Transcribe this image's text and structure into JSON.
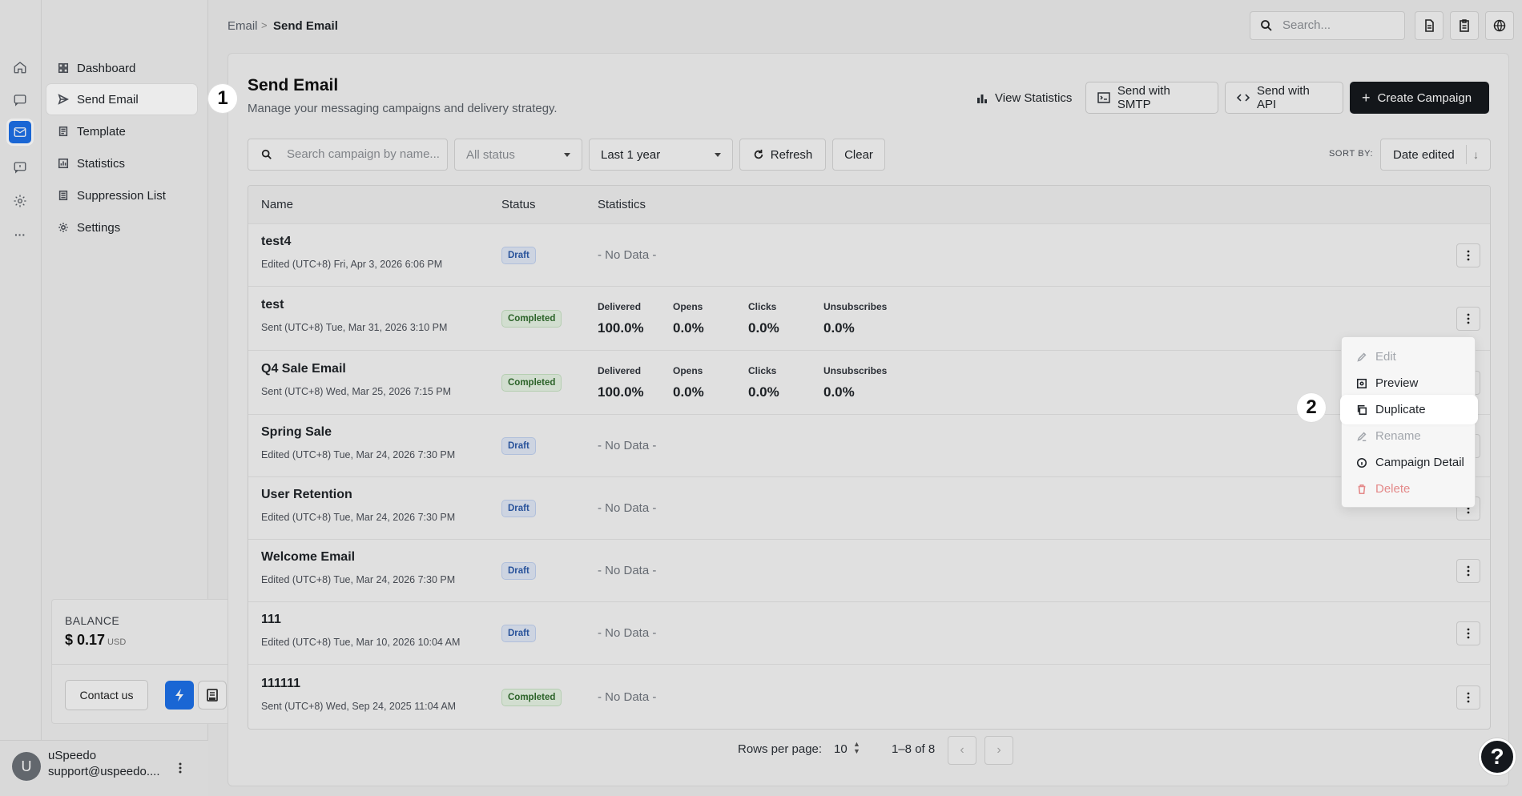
{
  "app": {
    "name": "uSpeedo",
    "brand_color": "#1d6fe6"
  },
  "rail": {
    "icons": [
      "home-icon",
      "chat-icon",
      "mail-icon",
      "feedback-icon",
      "gear-icon",
      "more-icon"
    ],
    "active": "mail-icon",
    "more_glyph": "···"
  },
  "sidebar": {
    "items": [
      {
        "label": "Dashboard",
        "icon": "grid-icon"
      },
      {
        "label": "Send Email",
        "icon": "send-icon",
        "active": true
      },
      {
        "label": "Template",
        "icon": "template-icon"
      },
      {
        "label": "Statistics",
        "icon": "chart-icon"
      },
      {
        "label": "Suppression List",
        "icon": "list-icon"
      },
      {
        "label": "Settings",
        "icon": "gear-icon"
      }
    ],
    "balance": {
      "label": "BALANCE",
      "amount": "$ 0.17",
      "currency": "USD"
    },
    "contact_label": "Contact us",
    "user": {
      "initial": "U",
      "name": "uSpeedo",
      "email": "support@uspeedo...."
    }
  },
  "header": {
    "breadcrumb": [
      "Email",
      "Send Email"
    ],
    "breadcrumb_sep": ">",
    "search_placeholder": "Search..."
  },
  "page": {
    "title": "Send Email",
    "subtitle": "Manage your messaging campaigns and delivery strategy.",
    "actions": {
      "view_statistics": "View Statistics",
      "send_smtp": "Send with SMTP",
      "send_api": "Send with API",
      "create_campaign": "Create Campaign",
      "create_glyph": "+"
    },
    "filters": {
      "search_placeholder": "Search campaign by name...",
      "status_placeholder": "All status",
      "period": "Last 1 year",
      "refresh": "Refresh",
      "clear": "Clear",
      "sort_by_label": "SORT BY:",
      "sort_by": "Date edited",
      "sort_dir_glyph": "↓"
    }
  },
  "table": {
    "columns": [
      "Name",
      "Status",
      "Statistics"
    ],
    "stat_labels": [
      "Delivered",
      "Opens",
      "Clicks",
      "Unsubscribes"
    ],
    "no_data": "- No Data -",
    "rows": [
      {
        "name": "test4",
        "meta": "Edited (UTC+8) Fri, Apr 3, 2026 6:06 PM",
        "status": "Draft",
        "stats": null
      },
      {
        "name": "test",
        "meta": "Sent (UTC+8) Tue, Mar 31, 2026 3:10 PM",
        "status": "Completed",
        "stats": [
          "100.0%",
          "0.0%",
          "0.0%",
          "0.0%"
        ]
      },
      {
        "name": "Q4 Sale Email",
        "meta": "Sent (UTC+8) Wed, Mar 25, 2026 7:15 PM",
        "status": "Completed",
        "stats": [
          "100.0%",
          "0.0%",
          "0.0%",
          "0.0%"
        ]
      },
      {
        "name": "Spring Sale",
        "meta": "Edited (UTC+8) Tue, Mar 24, 2026 7:30 PM",
        "status": "Draft",
        "stats": null
      },
      {
        "name": "User Retention",
        "meta": "Edited (UTC+8) Tue, Mar 24, 2026 7:30 PM",
        "status": "Draft",
        "stats": null
      },
      {
        "name": "Welcome Email",
        "meta": "Edited (UTC+8) Tue, Mar 24, 2026 7:30 PM",
        "status": "Draft",
        "stats": null
      },
      {
        "name": "111",
        "meta": "Edited (UTC+8) Tue, Mar 10, 2026 10:04 AM",
        "status": "Draft",
        "stats": null
      },
      {
        "name": "111111",
        "meta": "Sent (UTC+8) Wed, Sep 24, 2025 11:04 AM",
        "status": "Completed",
        "stats": null
      }
    ]
  },
  "pagination": {
    "rows_per_page_label": "Rows per page:",
    "rows_per_page": "10",
    "range": "1–8 of 8",
    "prev_glyph": "‹",
    "next_glyph": "›"
  },
  "context_menu": {
    "items": [
      {
        "label": "Edit",
        "icon": "pencil-icon",
        "state": "disabled"
      },
      {
        "label": "Preview",
        "icon": "preview-icon",
        "state": "normal"
      },
      {
        "label": "Duplicate",
        "icon": "copy-icon",
        "state": "highlight"
      },
      {
        "label": "Rename",
        "icon": "rename-icon",
        "state": "disabled"
      },
      {
        "label": "Campaign Detail",
        "icon": "info-icon",
        "state": "normal"
      },
      {
        "label": "Delete",
        "icon": "trash-icon",
        "state": "danger"
      }
    ]
  },
  "steps": [
    "1",
    "2"
  ],
  "help_glyph": "?"
}
